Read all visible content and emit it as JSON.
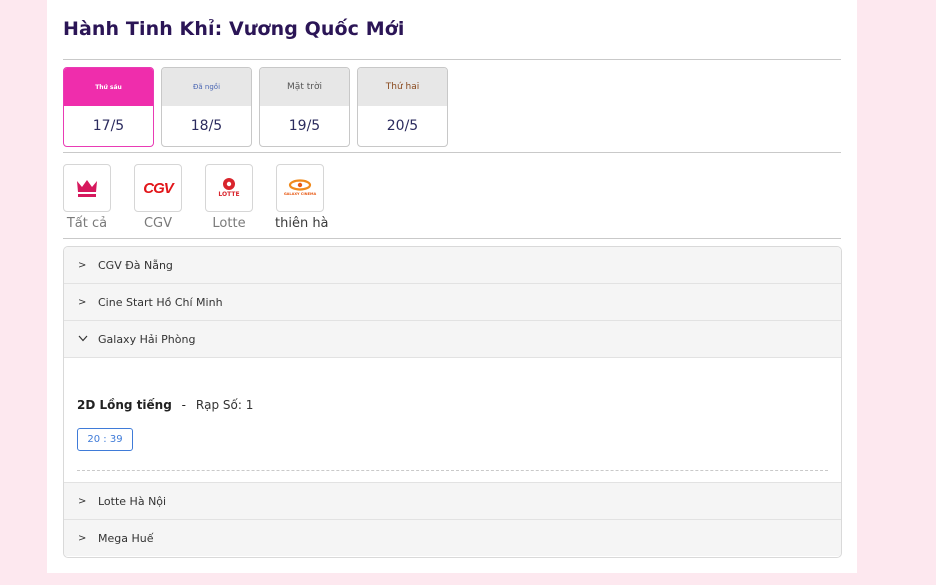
{
  "movie": {
    "title": "Hành Tinh Khỉ: Vương Quốc Mới"
  },
  "dates": [
    {
      "day": "Thứ sáu",
      "date": "17/5",
      "active": true
    },
    {
      "day": "Đã ngồi",
      "date": "18/5",
      "active": false
    },
    {
      "day": "Mặt trời",
      "date": "19/5",
      "active": false
    },
    {
      "day": "Thứ hai",
      "date": "20/5",
      "active": false
    }
  ],
  "cinemas": [
    {
      "name": "Tất cả",
      "icon": "crown-icon"
    },
    {
      "name": "CGV",
      "logo_text": "CGV",
      "icon": "cgv-logo"
    },
    {
      "name": "Lotte",
      "logo_text": "LOTTE",
      "icon": "lotte-logo"
    },
    {
      "name": "thiên hà",
      "logo_text": "GALAXY CINEMA",
      "icon": "galaxy-logo"
    }
  ],
  "theaters": [
    {
      "name": "CGV Đà Nẵng",
      "expanded": false
    },
    {
      "name": "Cine Start Hồ Chí Minh",
      "expanded": false
    },
    {
      "name": "Galaxy Hải Phòng",
      "expanded": true
    },
    {
      "name": "Lotte Hà Nội",
      "expanded": false
    },
    {
      "name": "Mega Huế",
      "expanded": false
    }
  ],
  "showing": {
    "format": "2D Lồng tiếng",
    "separator": "-",
    "room": "Rạp Số: 1",
    "times": [
      "20 : 39"
    ]
  },
  "colors": {
    "accent": "#ef2dac",
    "title": "#2b1556",
    "time_border": "#3f7bd8"
  }
}
